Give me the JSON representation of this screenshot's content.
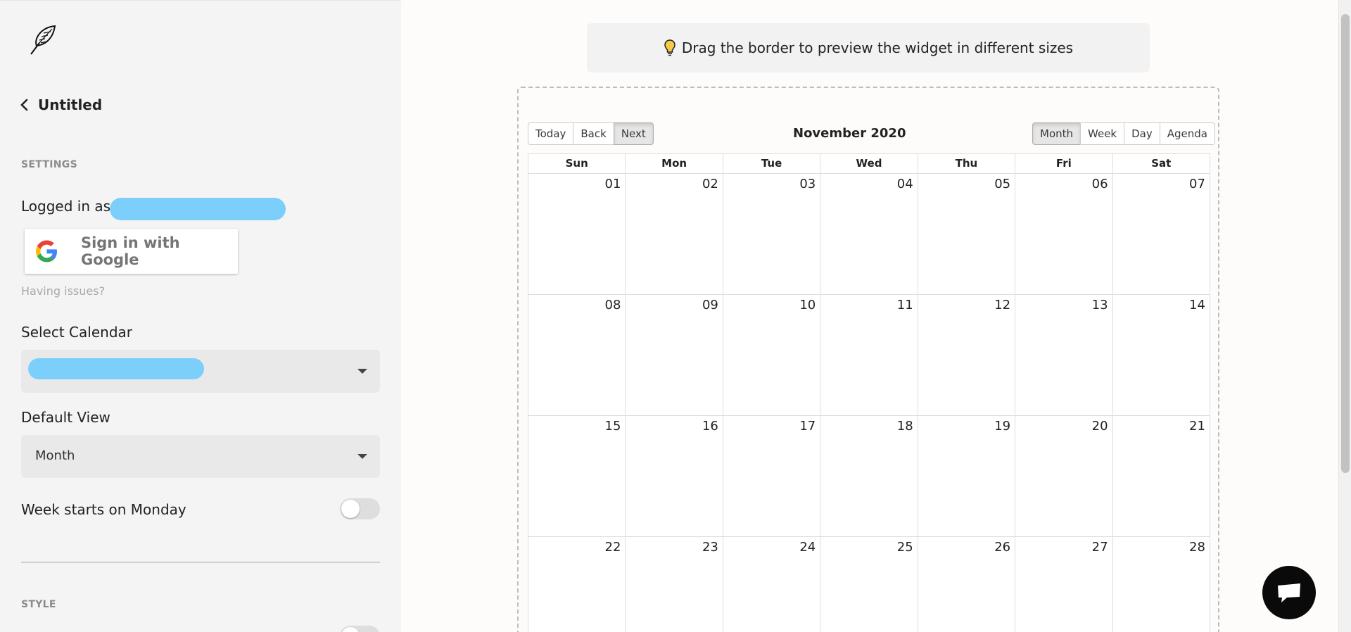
{
  "sidebar": {
    "back_title": "Untitled",
    "settings_label": "SETTINGS",
    "logged_in_label": "Logged in as:",
    "google_button_label": "Sign in with Google",
    "having_issues": "Having issues?",
    "select_calendar_label": "Select Calendar",
    "default_view_label": "Default View",
    "default_view_value": "Month",
    "week_starts_monday_label": "Week starts on Monday",
    "week_starts_monday_on": false,
    "style_label": "STYLE",
    "redaction_color": "#7ccffb"
  },
  "hint": {
    "text": "Drag the border to preview the widget in different sizes",
    "icon": "lightbulb-icon"
  },
  "calendar": {
    "nav_buttons": [
      "Today",
      "Back",
      "Next"
    ],
    "title": "November 2020",
    "view_buttons": [
      "Month",
      "Week",
      "Day",
      "Agenda"
    ],
    "active_view": "Month",
    "weekdays": [
      "Sun",
      "Mon",
      "Tue",
      "Wed",
      "Thu",
      "Fri",
      "Sat"
    ],
    "weeks": [
      [
        "01",
        "02",
        "03",
        "04",
        "05",
        "06",
        "07"
      ],
      [
        "08",
        "09",
        "10",
        "11",
        "12",
        "13",
        "14"
      ],
      [
        "15",
        "16",
        "17",
        "18",
        "19",
        "20",
        "21"
      ],
      [
        "22",
        "23",
        "24",
        "25",
        "26",
        "27",
        "28"
      ]
    ]
  },
  "chat": {
    "icon": "chat-bubble-icon"
  }
}
